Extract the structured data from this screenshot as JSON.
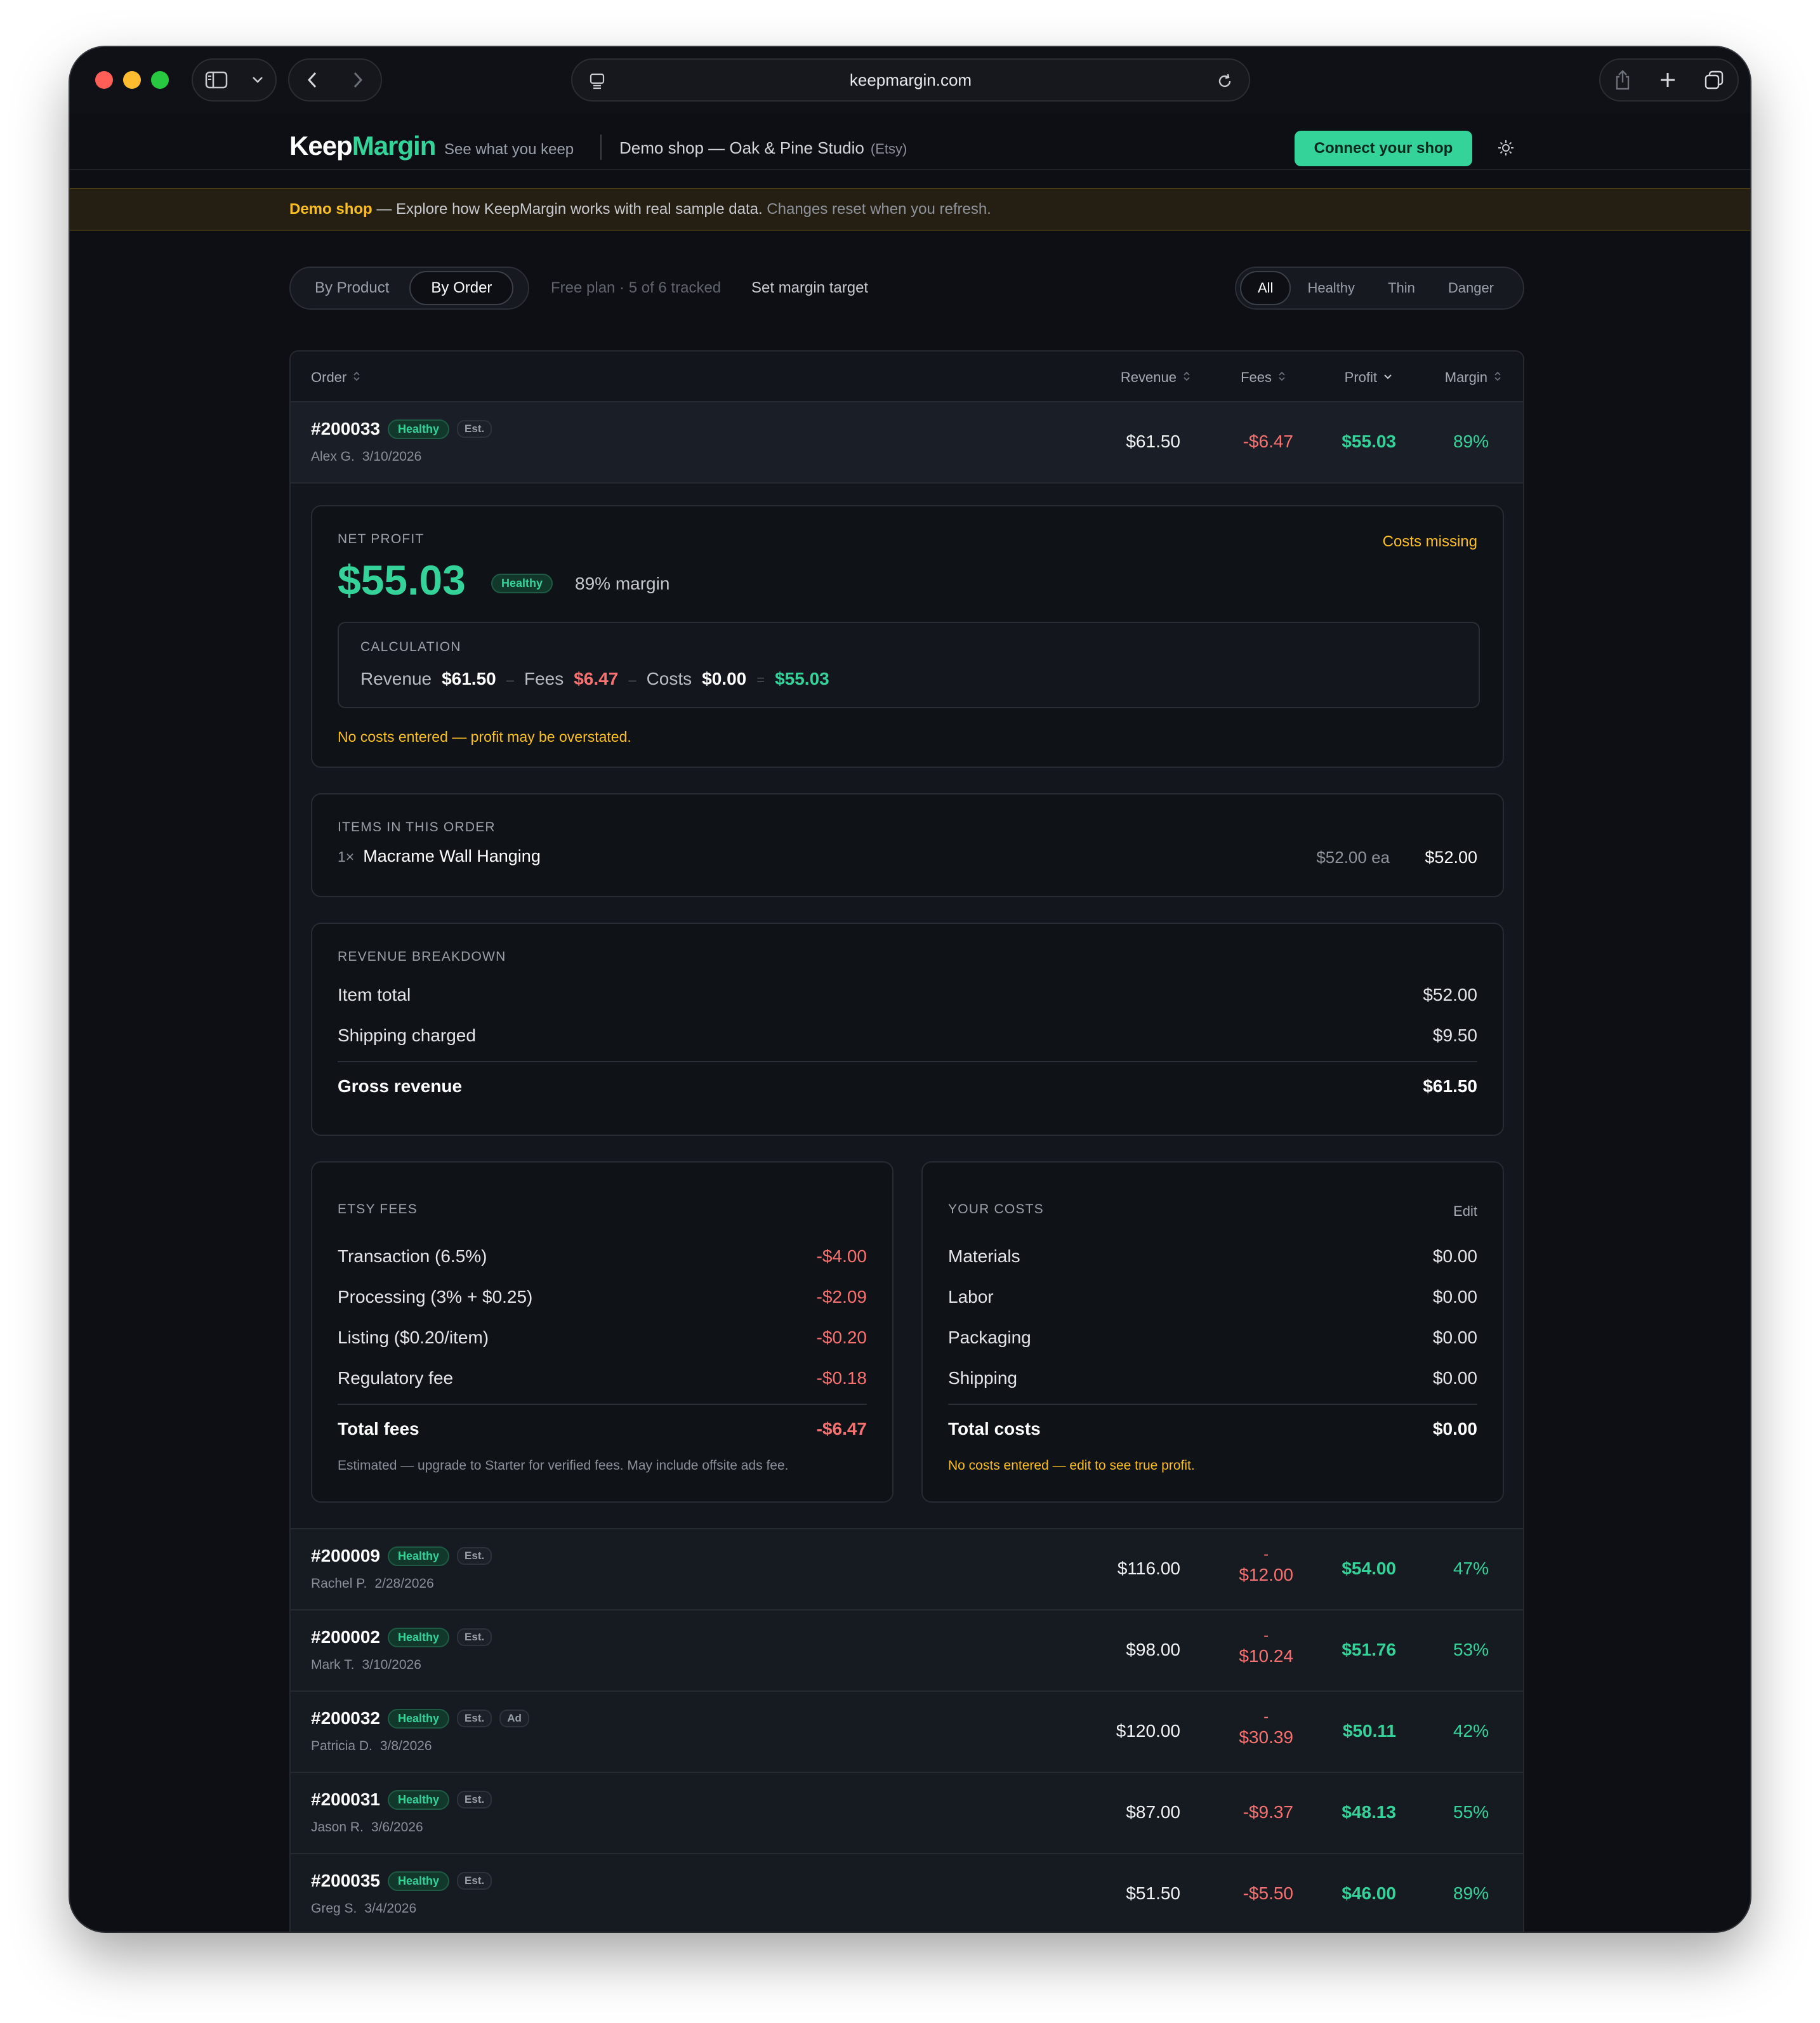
{
  "browser": {
    "url": "keepmargin.com"
  },
  "header": {
    "logo_keep": "Keep",
    "logo_margin": "Margin",
    "tagline": "See what you keep",
    "shop_name": "Demo shop — Oak & Pine Studio",
    "platform": "(Etsy)",
    "connect_label": "Connect your shop"
  },
  "banner": {
    "demo_label": "Demo shop",
    "text": " — Explore how KeepMargin works with real sample data.",
    "muted": " Changes reset when you refresh."
  },
  "controls": {
    "view_tabs": [
      "By Product",
      "By Order"
    ],
    "active_view": "By Order",
    "plan_text": "Free plan · 5 of 6 tracked",
    "target_link": "Set margin target",
    "filters": [
      "All",
      "Healthy",
      "Thin",
      "Danger"
    ],
    "active_filter": "All"
  },
  "table": {
    "columns": {
      "order": "Order",
      "revenue": "Revenue",
      "fees": "Fees",
      "profit": "Profit",
      "margin": "Margin"
    },
    "status_label": "Healthy",
    "est_label": "Est.",
    "ad_label": "Ad",
    "expanded": {
      "id": "#200033",
      "customer": "Alex G.",
      "date": "3/10/2026",
      "revenue": "$61.50",
      "fees": "-$6.47",
      "profit": "$55.03",
      "margin": "89%"
    },
    "rows": [
      {
        "id": "#200009",
        "customer": "Rachel P.",
        "date": "2/28/2026",
        "revenue": "$116.00",
        "fees_sign": "-",
        "fees": "$12.00",
        "profit": "$54.00",
        "margin": "47%",
        "ad": false
      },
      {
        "id": "#200002",
        "customer": "Mark T.",
        "date": "3/10/2026",
        "revenue": "$98.00",
        "fees_sign": "-",
        "fees": "$10.24",
        "profit": "$51.76",
        "margin": "53%",
        "ad": false
      },
      {
        "id": "#200032",
        "customer": "Patricia D.",
        "date": "3/8/2026",
        "revenue": "$120.00",
        "fees_sign": "-",
        "fees": "$30.39",
        "profit": "$50.11",
        "margin": "42%",
        "ad": true
      },
      {
        "id": "#200031",
        "customer": "Jason R.",
        "date": "3/6/2026",
        "revenue": "$87.00",
        "fees_sign": "",
        "fees": "-$9.37",
        "profit": "$48.13",
        "margin": "55%",
        "ad": false
      },
      {
        "id": "#200035",
        "customer": "Greg S.",
        "date": "3/4/2026",
        "revenue": "$51.50",
        "fees_sign": "",
        "fees": "-$5.50",
        "profit": "$46.00",
        "margin": "89%",
        "ad": false
      }
    ]
  },
  "detail": {
    "net_profit_label": "NET PROFIT",
    "net_profit": "$55.03",
    "status": "Healthy",
    "margin_text": "89% margin",
    "costs_missing": "Costs missing",
    "calc_label": "CALCULATION",
    "calc": {
      "revenue_label": "Revenue",
      "revenue": "$61.50",
      "fees_label": "Fees",
      "fees": "$6.47",
      "costs_label": "Costs",
      "costs": "$0.00",
      "result": "$55.03",
      "minus": "–",
      "equals": "="
    },
    "warning": "No costs entered — profit may be overstated.",
    "items_label": "ITEMS IN THIS ORDER",
    "items": [
      {
        "qty": "1×",
        "name": "Macrame Wall Hanging",
        "each": "$52.00 ea",
        "total": "$52.00"
      }
    ],
    "revenue_label": "REVENUE BREAKDOWN",
    "revenue_lines": [
      {
        "label": "Item total",
        "value": "$52.00"
      },
      {
        "label": "Shipping charged",
        "value": "$9.50"
      }
    ],
    "gross_label": "Gross revenue",
    "gross_value": "$61.50",
    "fees_label": "ETSY FEES",
    "fee_lines": [
      {
        "label": "Transaction (6.5%)",
        "value": "-$4.00"
      },
      {
        "label": "Processing (3% + $0.25)",
        "value": "-$2.09"
      },
      {
        "label": "Listing ($0.20/item)",
        "value": "-$0.20"
      },
      {
        "label": "Regulatory fee",
        "value": "-$0.18"
      }
    ],
    "total_fees_label": "Total fees",
    "total_fees": "-$6.47",
    "fees_note": "Estimated — upgrade to Starter for verified fees. May include offsite ads fee.",
    "costs_label": "YOUR COSTS",
    "edit_label": "Edit",
    "cost_lines": [
      {
        "label": "Materials",
        "value": "$0.00"
      },
      {
        "label": "Labor",
        "value": "$0.00"
      },
      {
        "label": "Packaging",
        "value": "$0.00"
      },
      {
        "label": "Shipping",
        "value": "$0.00"
      }
    ],
    "total_costs_label": "Total costs",
    "total_costs": "$0.00",
    "costs_note": "No costs entered — edit to see true profit."
  },
  "colors": {
    "accent_green": "#34d399",
    "negative_red": "#f87171",
    "warning_amber": "#fbbf24",
    "background": "#0d0f14"
  }
}
